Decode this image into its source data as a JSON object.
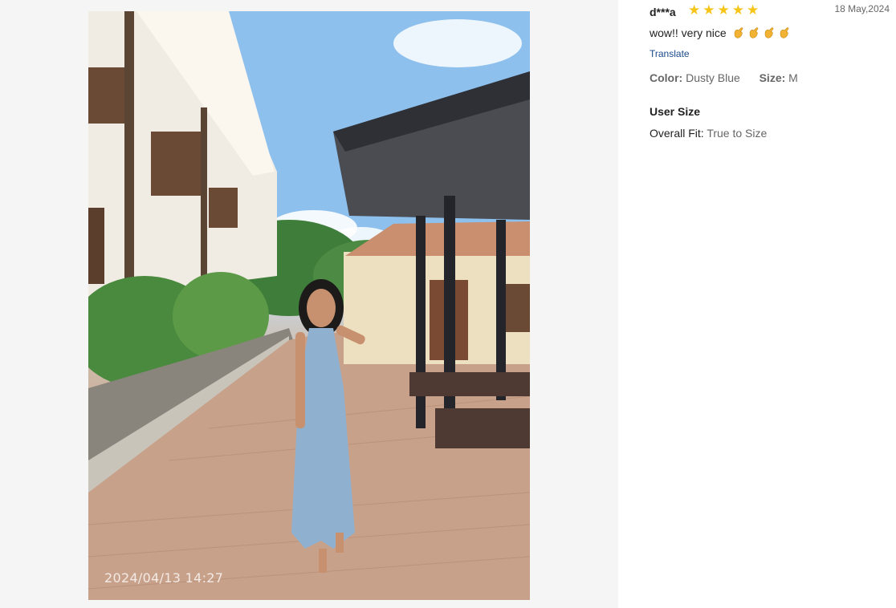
{
  "gallery": {
    "photo_alt": "Customer photo wearing the jumpsuit",
    "timestamp": "2024/04/13 14:27"
  },
  "review": {
    "reviewer": "d***a",
    "rating": 5,
    "rating_max": 5,
    "date": "18 May,2024",
    "text": "wow!! very nice",
    "emoji_count": 4,
    "translate_label": "Translate",
    "color_label": "Color:",
    "color_value": "Dusty Blue",
    "size_label": "Size:",
    "size_value": "M",
    "user_size_title": "User Size",
    "fit_label": "Overall Fit:",
    "fit_value": "True to Size"
  },
  "colors": {
    "star": "#f5c518",
    "link": "#1a4a8a",
    "dress": "#8fb0cf"
  }
}
